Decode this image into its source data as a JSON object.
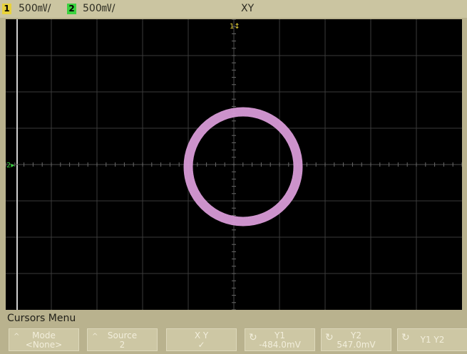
{
  "topbar": {
    "ch1": {
      "number": "1",
      "scale": "500㎷/",
      "color": "#e8d23a"
    },
    "ch2": {
      "number": "2",
      "scale": "500㎷/",
      "color": "#3bd23f"
    },
    "mode": "XY"
  },
  "screen": {
    "x_origin_marker": "1",
    "y_origin_marker": "2",
    "trace_color": "#d79ad6"
  },
  "menu": {
    "title": "Cursors Menu",
    "softkeys": [
      {
        "label": "Mode",
        "value": "<None>",
        "indicator": "^"
      },
      {
        "label": "Source",
        "value": "2",
        "indicator": "^"
      },
      {
        "label": "X      Y",
        "value": "✓",
        "indicator": ""
      },
      {
        "label": "Y1",
        "value": "-484.0mV",
        "indicator": "knob"
      },
      {
        "label": "Y2",
        "value": "547.0mV",
        "indicator": "knob"
      },
      {
        "label": "Y1 Y2",
        "value": "",
        "indicator": "knob"
      }
    ]
  }
}
